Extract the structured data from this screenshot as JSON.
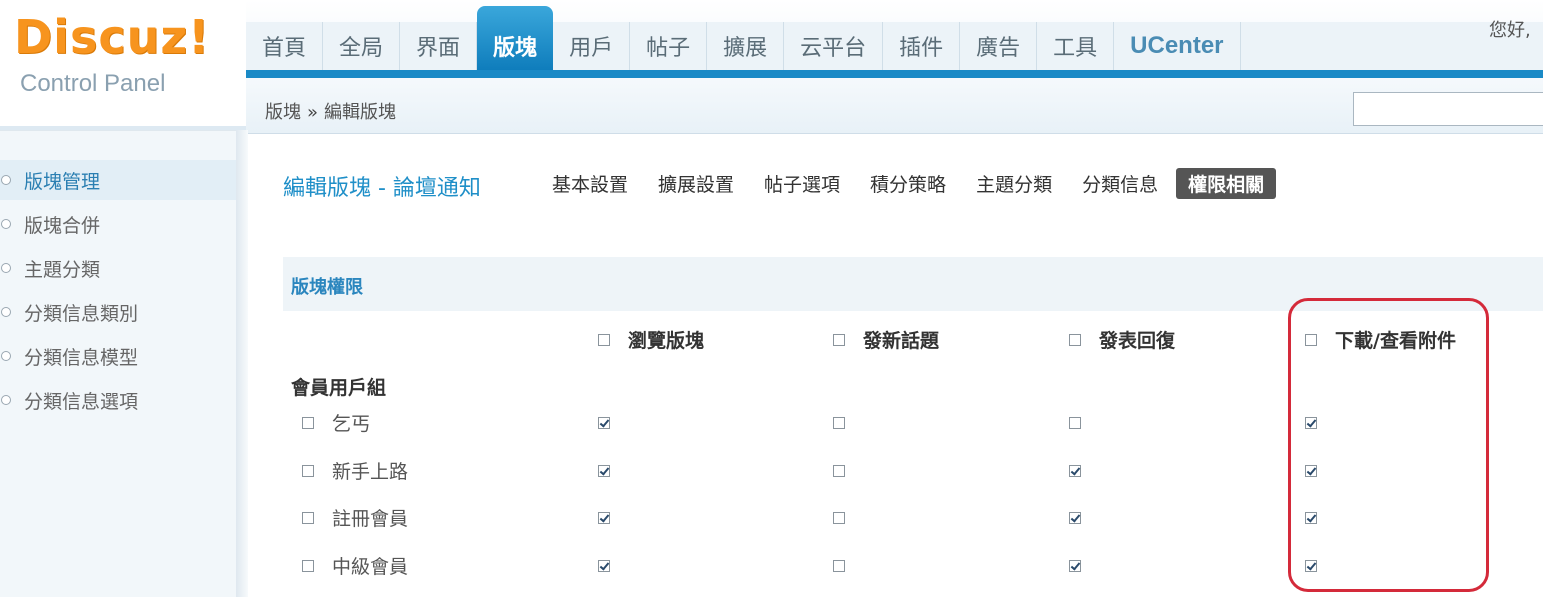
{
  "logo": {
    "title": "Discuz!",
    "subtitle": "Control Panel"
  },
  "nav": {
    "items": [
      {
        "label": "首頁",
        "active": false
      },
      {
        "label": "全局",
        "active": false
      },
      {
        "label": "界面",
        "active": false
      },
      {
        "label": "版塊",
        "active": true
      },
      {
        "label": "用戶",
        "active": false
      },
      {
        "label": "帖子",
        "active": false
      },
      {
        "label": "擴展",
        "active": false
      },
      {
        "label": "云平台",
        "active": false
      },
      {
        "label": "插件",
        "active": false
      },
      {
        "label": "廣告",
        "active": false
      },
      {
        "label": "工具",
        "active": false
      },
      {
        "label": "UCenter",
        "active": false
      }
    ],
    "greeting": "您好,"
  },
  "breadcrumb": {
    "root": "版塊",
    "separator": "»",
    "current": "編輯版塊"
  },
  "sidebar": {
    "items": [
      {
        "label": "版塊管理",
        "active": true
      },
      {
        "label": "版塊合併",
        "active": false
      },
      {
        "label": "主題分類",
        "active": false
      },
      {
        "label": "分類信息類別",
        "active": false
      },
      {
        "label": "分類信息模型",
        "active": false
      },
      {
        "label": "分類信息選項",
        "active": false
      }
    ]
  },
  "page": {
    "title": "編輯版塊 - 論壇通知",
    "tabs": [
      {
        "label": "基本設置",
        "active": false
      },
      {
        "label": "擴展設置",
        "active": false
      },
      {
        "label": "帖子選項",
        "active": false
      },
      {
        "label": "積分策略",
        "active": false
      },
      {
        "label": "主題分類",
        "active": false
      },
      {
        "label": "分類信息",
        "active": false
      },
      {
        "label": "權限相關",
        "active": true
      }
    ]
  },
  "permissions": {
    "section_title": "版塊權限",
    "columns": [
      {
        "label": "瀏覽版塊",
        "checked": false
      },
      {
        "label": "發新話題",
        "checked": false
      },
      {
        "label": "發表回復",
        "checked": false
      },
      {
        "label": "下載/查看附件",
        "checked": false
      }
    ],
    "group_title": "會員用戶組",
    "rows": [
      {
        "label": "乞丐",
        "row_checked": false,
        "values": [
          true,
          false,
          false,
          true
        ]
      },
      {
        "label": "新手上路",
        "row_checked": false,
        "values": [
          true,
          false,
          true,
          true
        ]
      },
      {
        "label": "註冊會員",
        "row_checked": false,
        "values": [
          true,
          false,
          true,
          true
        ]
      },
      {
        "label": "中級會員",
        "row_checked": false,
        "values": [
          true,
          false,
          true,
          true
        ]
      }
    ]
  },
  "colors": {
    "accent": "#1a8ac6",
    "highlight": "#d42a3a",
    "logo": "#f7941e"
  }
}
